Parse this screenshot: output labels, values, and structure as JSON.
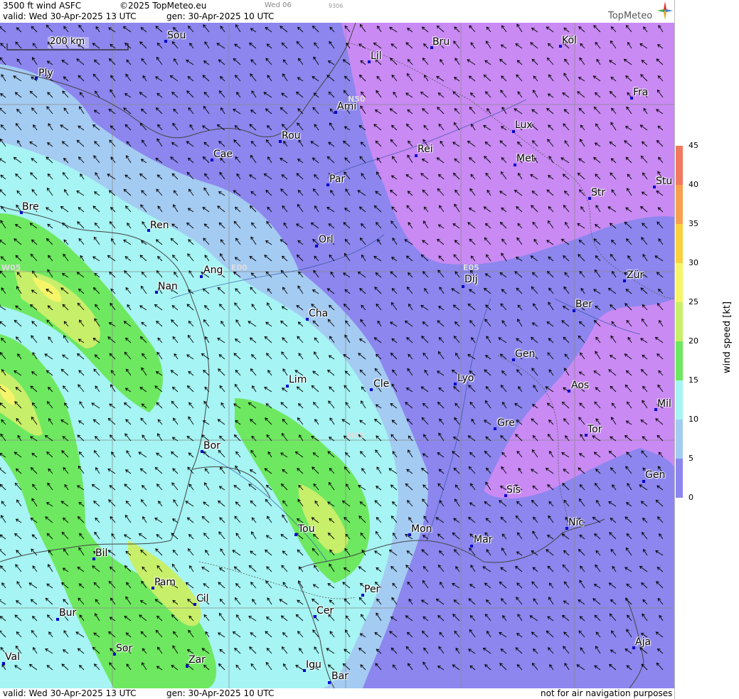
{
  "header": {
    "product": "3500 ft wind ASFC",
    "copyright": "©2025 TopMeteo.eu",
    "run_day": "Wed 06",
    "code": "9306",
    "valid": "valid:  Wed  30-Apr-2025  13 UTC",
    "gen": "gen: 30-Apr-2025 10 UTC",
    "brand": "TopMeteo"
  },
  "footer": {
    "valid": "valid:  Wed  30-Apr-2025  13 UTC",
    "gen": "gen: 30-Apr-2025 10 UTC",
    "disclaimer": "not for air navigation purposes"
  },
  "scale_bar": "200 km",
  "grid_labels": [
    "N50",
    "N45",
    "W05",
    "E00",
    "E05"
  ],
  "colorbar": {
    "label": "wind  speed  [kt]",
    "ticks": [
      "45",
      "40",
      "35",
      "30",
      "25",
      "20",
      "15",
      "10",
      "5",
      "0"
    ],
    "colors": [
      "#f07a60",
      "#f7a050",
      "#fbd040",
      "#f6f56a",
      "#c8ef6a",
      "#6ee860",
      "#a6f4f4",
      "#a4cbf2",
      "#8c86ee",
      "#c98af4"
    ]
  },
  "cities": [
    "Sou",
    "Ply",
    "Lil",
    "Bru",
    "Köl",
    "Ami",
    "Fra",
    "Rou",
    "Lux",
    "Cae",
    "Rei",
    "Met",
    "Par",
    "Str",
    "Stu",
    "Bre",
    "Ren",
    "Orl",
    "Ang",
    "Nan",
    "Dij",
    "Zür",
    "Cha",
    "Ber",
    "Gen",
    "Lim",
    "Cle",
    "Lyo",
    "Aos",
    "Mil",
    "Bor",
    "Gre",
    "Tor",
    "Sis",
    "Gen",
    "Tou",
    "Mon",
    "Mar",
    "Nic",
    "Bil",
    "Pam",
    "Cil",
    "Per",
    "Cer",
    "Bur",
    "Aja",
    "Sor",
    "Val",
    "Zar",
    "Igu",
    "Bar"
  ],
  "colors": {
    "dominant": "#c98af4",
    "arrow": "#000000"
  }
}
